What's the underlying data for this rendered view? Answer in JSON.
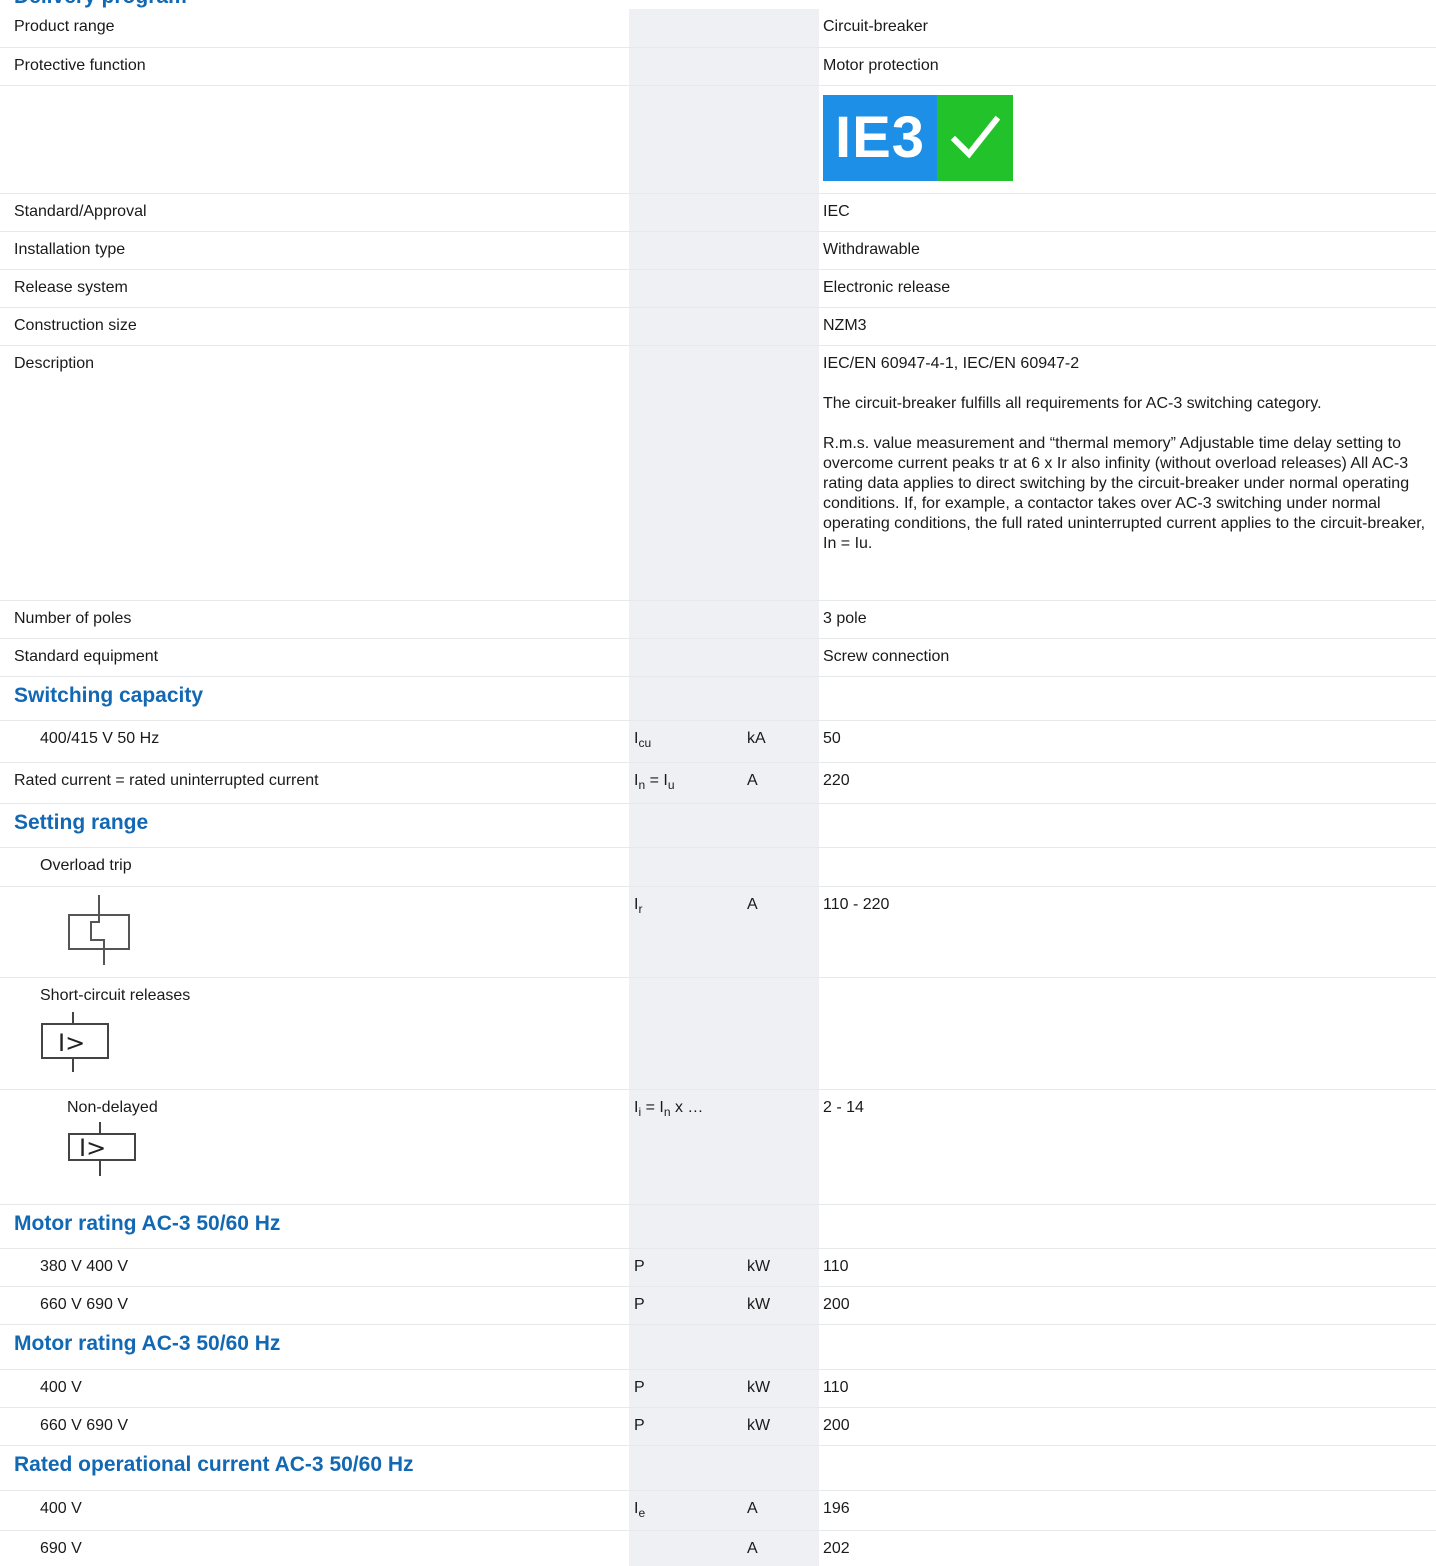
{
  "page": {
    "heading": "Delivery program"
  },
  "badge": {
    "text": "IE3",
    "colors": {
      "text_bg": "#1e8fe6",
      "check_bg": "#22c22a"
    },
    "icon": "checkmark-icon"
  },
  "rows": {
    "product_range": {
      "label": "Product range",
      "value": "Circuit-breaker"
    },
    "protective_function": {
      "label": "Protective function",
      "value": "Motor protection"
    },
    "standard": {
      "label": "Standard/Approval",
      "value": "IEC"
    },
    "installation": {
      "label": "Installation type",
      "value": "Withdrawable"
    },
    "release": {
      "label": "Release system",
      "value": "Electronic release"
    },
    "size": {
      "label": "Construction size",
      "value": "NZM3"
    },
    "description": {
      "label": "Description",
      "p1": "IEC/EN 60947-4-1, IEC/EN 60947-2",
      "p2": "The circuit-breaker fulfills all requirements for AC-3 switching category.",
      "p3": "R.m.s. value measurement and “thermal memory” Adjustable time delay setting to overcome current peaks tr at 6 x Ir also infinity (without overload releases) All AC-3 rating data applies to direct switching by the circuit-breaker under normal operating conditions. If, for example, a contactor takes over AC-3 switching under normal operating conditions, the full rated uninterrupted current applies to the circuit-breaker, In = Iu."
    },
    "poles": {
      "label": "Number of poles",
      "value": "3 pole"
    },
    "equipment": {
      "label": "Standard equipment",
      "value": "Screw connection"
    }
  },
  "switching": {
    "title": "Switching capacity",
    "r1": {
      "label": "400/415 V 50 Hz",
      "sym": "I",
      "sym_sub": "cu",
      "unit": "kA",
      "value": "50"
    },
    "r2": {
      "label": "Rated current = rated uninterrupted current",
      "sym_a": "I",
      "sym_a_sub": "n",
      "sym_mid": " = I",
      "sym_b_sub": "u",
      "unit": "A",
      "value": "220"
    }
  },
  "setting": {
    "title": "Setting range",
    "overload": {
      "label": "Overload trip",
      "sym": "I",
      "sym_sub": "r",
      "unit": "A",
      "value": "110 - 220",
      "icon": "overload-release-icon"
    },
    "short_circuit": {
      "label": "Short-circuit releases",
      "icon": "short-circuit-release-icon",
      "glyph": "I>"
    },
    "non_delayed": {
      "label": "Non-delayed",
      "sym_a": "I",
      "sym_a_sub": "i",
      "sym_mid": " = I",
      "sym_b_sub": "n",
      "sym_tail": " x …",
      "value": "2 - 14",
      "icon": "instantaneous-release-icon",
      "glyph": "I>"
    }
  },
  "motor1": {
    "title": "Motor rating AC-3 50/60 Hz",
    "r1": {
      "label": "380 V 400 V",
      "sym": "P",
      "unit": "kW",
      "value": "110"
    },
    "r2": {
      "label": "660 V 690 V",
      "sym": "P",
      "unit": "kW",
      "value": "200"
    }
  },
  "motor2": {
    "title": "Motor rating AC-3 50/60 Hz",
    "r1": {
      "label": "400 V",
      "sym": "P",
      "unit": "kW",
      "value": "110"
    },
    "r2": {
      "label": "660 V 690 V",
      "sym": "P",
      "unit": "kW",
      "value": "200"
    }
  },
  "operational": {
    "title": "Rated operational current AC-3 50/60 Hz",
    "r1": {
      "label": "400 V",
      "sym": "I",
      "sym_sub": "e",
      "unit": "A",
      "value": "196"
    },
    "r2": {
      "label": "690 V",
      "unit": "A",
      "value": "202"
    }
  }
}
